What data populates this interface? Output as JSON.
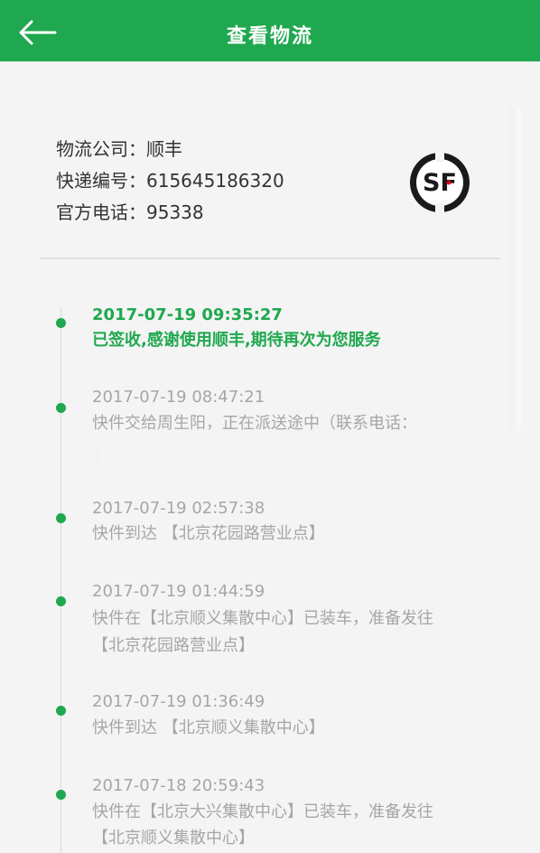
{
  "header": {
    "title": "查看物流"
  },
  "info": {
    "company_label": "物流公司：",
    "company_value": "顺丰",
    "tracking_label": "快递编号：",
    "tracking_value": "615645186320",
    "phone_label": "官方电话：",
    "phone_value": "95338"
  },
  "logo": {
    "brand": "SF"
  },
  "events": [
    {
      "time": "2017-07-19 09:35:27",
      "desc1": "已签收,感谢使用顺丰,期待再次为您服务"
    },
    {
      "time": "2017-07-19 08:47:21",
      "desc1": "快件交给周生阳，正在派送途中（联系电话：",
      "desc2": "1"
    },
    {
      "time": "2017-07-19 02:57:38",
      "desc1": "快件到达 【北京花园路营业点】"
    },
    {
      "time": "2017-07-19 01:44:59",
      "desc1": "快件在【北京顺义集散中心】已装车，准备发往",
      "desc2": "【北京花园路营业点】"
    },
    {
      "time": "2017-07-19 01:36:49",
      "desc1": "快件到达 【北京顺义集散中心】"
    },
    {
      "time": "2017-07-18 20:59:43",
      "desc1": "快件在【北京大兴集散中心】已装车，准备发往",
      "desc2": "【北京顺义集散中心】"
    }
  ],
  "colors": {
    "accent": "#1fa84f",
    "secondary_text": "#a6a6a6",
    "background": "#f4f4f4"
  }
}
